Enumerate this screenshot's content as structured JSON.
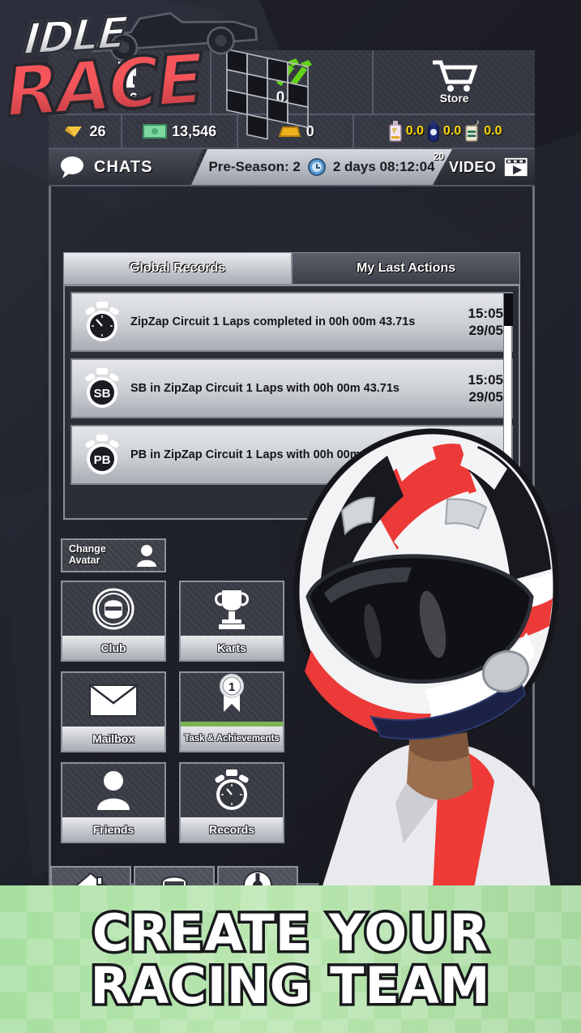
{
  "logo": {
    "line1": "IDLE",
    "line2": "RACE"
  },
  "hud": {
    "top_row": [
      {
        "icon": "fuel-pump-icon",
        "value": "26"
      },
      {
        "icon": "wrench-icon",
        "value": "0,00"
      },
      {
        "icon": "shopping-cart-icon",
        "value": "Store"
      }
    ],
    "resources": [
      {
        "icon": "diamond-icon",
        "value": "26"
      },
      {
        "icon": "money-icon",
        "value": "13,546"
      },
      {
        "icon": "gold-bar-icon",
        "value": "0"
      },
      {
        "icon": "coolant-bottle-icon",
        "value": "0.0"
      },
      {
        "icon": "nitro-bottle-icon",
        "value": "0.0"
      },
      {
        "icon": "oil-bottle-icon",
        "value": "0.0"
      }
    ],
    "chats_label": "CHATS",
    "season_label": "Pre-Season: 2",
    "timer": "2 days 08:12:04",
    "video_badge": "20",
    "video_label": "VIDEO"
  },
  "tabs": [
    {
      "label": "Global Records",
      "active": true
    },
    {
      "label": "My Last Actions",
      "active": false
    }
  ],
  "records": [
    {
      "icon": "stopwatch-icon",
      "text": "ZipZap Circuit 1 Laps completed in 00h 00m 43.71s",
      "time": "15:05",
      "date": "29/05"
    },
    {
      "icon": "stopwatch-sb-icon",
      "text": "SB in ZipZap Circuit 1 Laps with 00h 00m 43.71s",
      "time": "15:05",
      "date": "29/05"
    },
    {
      "icon": "stopwatch-pb-icon",
      "text": "PB in ZipZap Circuit 1 Laps with 00h 00m 43.71s",
      "time": "",
      "date": ""
    }
  ],
  "change_avatar": {
    "line1": "Change",
    "line2": "Avatar",
    "icon": "avatar-icon"
  },
  "menu_tiles": [
    {
      "label": "Club",
      "icon": "club-helmet-icon",
      "badge": "",
      "green_bar": false
    },
    {
      "label": "Karts",
      "icon": "trophy-icon",
      "badge": "",
      "green_bar": false
    },
    {
      "label": "Mailbox",
      "icon": "envelope-icon",
      "badge": "",
      "green_bar": false
    },
    {
      "label": "Task & Achievements",
      "icon": "medal-icon",
      "badge": "1",
      "green_bar": true
    },
    {
      "label": "Friends",
      "icon": "person-icon",
      "badge": "",
      "green_bar": false
    },
    {
      "label": "Records",
      "icon": "stopwatch-icon",
      "badge": "",
      "green_bar": false
    }
  ],
  "bottom_nav": [
    {
      "icon": "home-icon"
    },
    {
      "icon": "car-icon"
    },
    {
      "icon": "wheel-icon"
    }
  ],
  "banner": {
    "line1": "CREATE YOUR",
    "line2": "RACING TEAM"
  },
  "colors": {
    "brand_red": "#f4555a",
    "accent_green": "#7cb354",
    "banner_green": "#a6dfa0",
    "resource_yellow": "#ffd800",
    "wrench_green": "#63d317"
  }
}
